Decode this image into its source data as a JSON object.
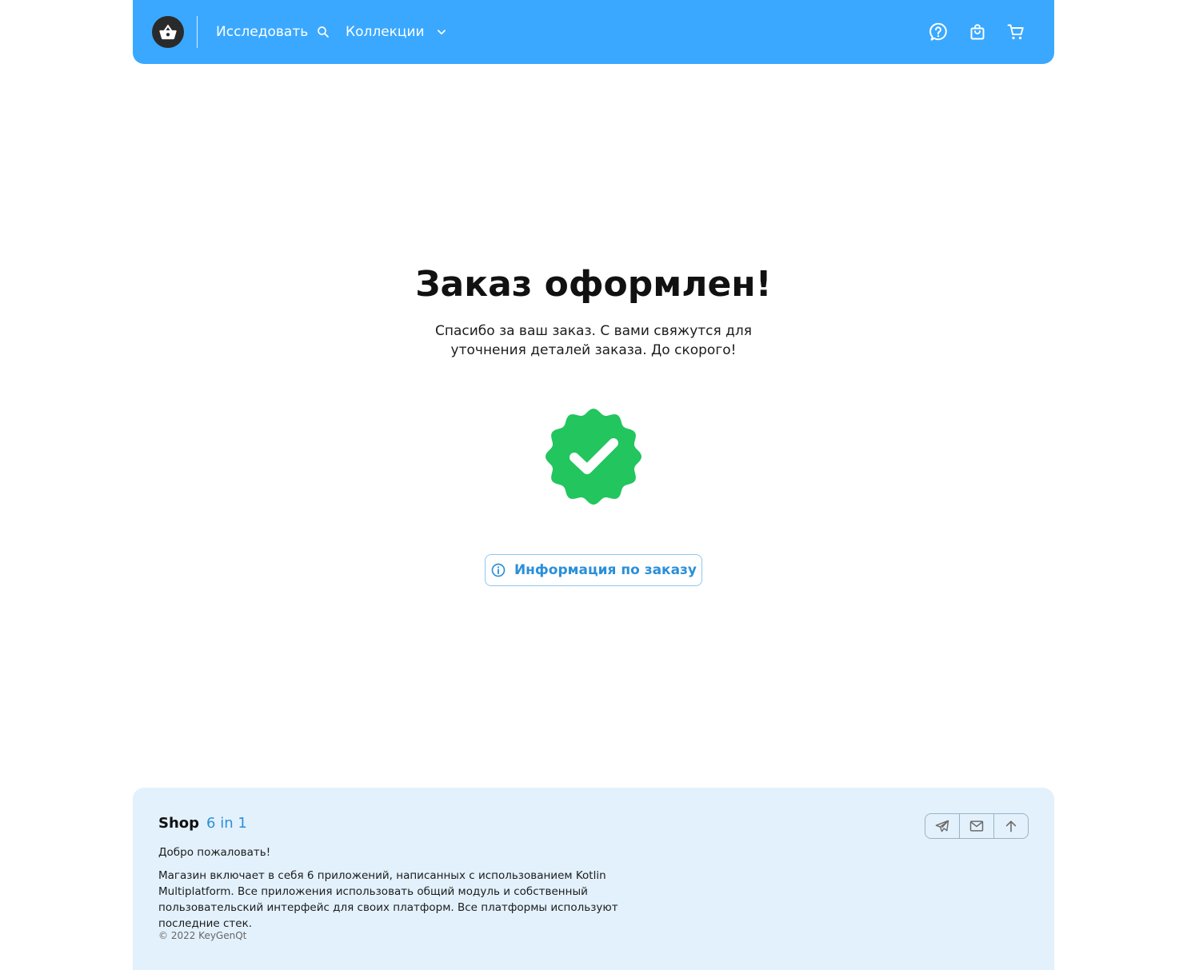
{
  "header": {
    "logo_icon": "shopping-basket-icon",
    "nav": {
      "explore_label": "Исследовать",
      "explore_icon": "search-icon",
      "collections_label": "Коллекции",
      "collections_icon": "chevron-down-icon"
    },
    "actions": [
      "help-icon",
      "shopping-bag-icon",
      "cart-icon"
    ],
    "background_color": "#3aa8ff"
  },
  "main": {
    "title": "Заказ оформлен!",
    "subtitle": "Спасибо за ваш заказ. С вами свяжутся для уточнения деталей заказа. До скорого!",
    "status_icon": "verified-badge-icon",
    "status_color": "#22c55e",
    "order_info_button": {
      "label": "Информация по заказу",
      "icon": "info-icon"
    }
  },
  "footer": {
    "brand_name": "Shop",
    "brand_sub": "6 in 1",
    "welcome": "Добро пожаловать!",
    "description": "Магазин включает в себя 6 приложений, написанных с использованием Kotlin Multiplatform. Все приложения использовать общий модуль и собственный пользовательский интерфейс для своих платформ. Все платформы используют последние стек.",
    "copyright": "© 2022 KeyGenQt",
    "actions": [
      "telegram-icon",
      "email-icon",
      "arrow-up-icon"
    ],
    "background_color": "#e3f1fc"
  }
}
